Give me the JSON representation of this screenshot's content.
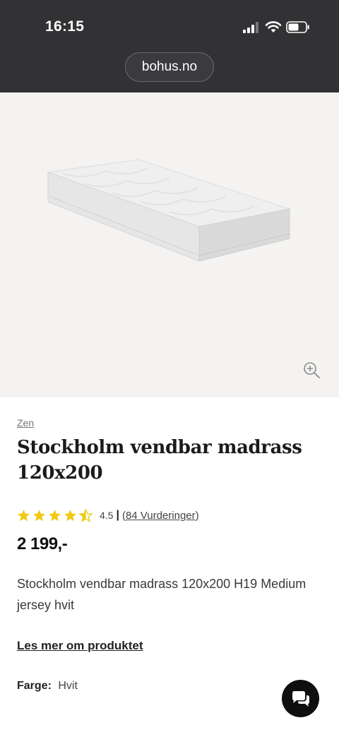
{
  "status_bar": {
    "time": "16:15",
    "icons": [
      "cellular-signal-icon",
      "wifi-icon",
      "battery-icon"
    ]
  },
  "browser": {
    "url": "bohus.no"
  },
  "product": {
    "image_icon": "mattress-image",
    "zoom_icon": "zoom-in-icon",
    "brand": "Zen",
    "title": "Stockholm vendbar madrass 120x200",
    "rating": {
      "value": "4.5",
      "stars_filled": 4.5,
      "stars_total": 5,
      "separator": "|",
      "reviews_label": "(84 Vurderinger)"
    },
    "price": "2 199,-",
    "description": "Stockholm vendbar madrass 120x200 H19 Medium jersey hvit",
    "read_more_label": "Les mer om produktet",
    "color": {
      "label": "Farge:",
      "value": "Hvit"
    }
  },
  "chat": {
    "icon": "chat-bubbles-icon"
  },
  "colors": {
    "status_bar_bg": "#323235",
    "image_bg": "#f4f3f1",
    "star": "#f2c811",
    "chat_bg": "#0f0f0f"
  }
}
